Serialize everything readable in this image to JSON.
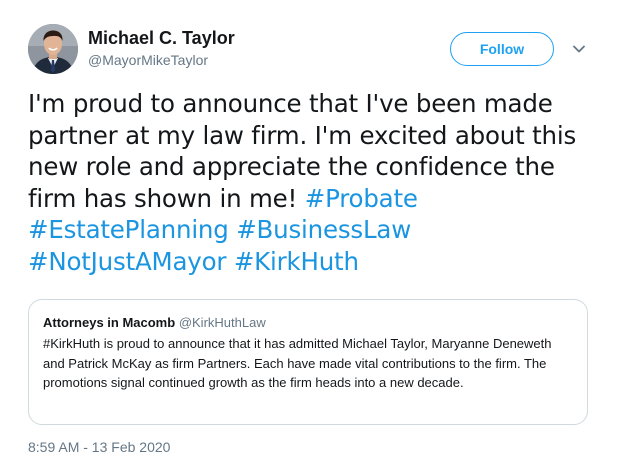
{
  "author": {
    "name": "Michael C. Taylor",
    "handle": "@MayorMikeTaylor",
    "avatar_icon": "profile-photo"
  },
  "follow_button": {
    "label": "Follow"
  },
  "menu": {
    "icon": "chevron-down-icon"
  },
  "tweet": {
    "text_part1": "I'm proud to announce that I've been made partner at my law firm. I'm excited about this new role and appreciate the confidence the firm has shown in me! ",
    "hashtags": [
      "#Probate",
      "#EstatePlanning",
      "#BusinessLaw",
      "#NotJustAMayor",
      "#KirkHuth"
    ]
  },
  "quoted_tweet": {
    "name": "Attorneys in Macomb",
    "handle": "@KirkHuthLaw",
    "text": "#KirkHuth is proud to announce that it has admitted Michael Taylor, Maryanne Deneweth and Patrick McKay as firm Partners. Each have made vital contributions to the firm. The promotions signal continued growth as the firm heads into a new decade."
  },
  "timestamp": "8:59 AM - 13 Feb 2020",
  "colors": {
    "link": "#1b95e0",
    "follow_border": "#1da1f2",
    "secondary_text": "#657786"
  }
}
